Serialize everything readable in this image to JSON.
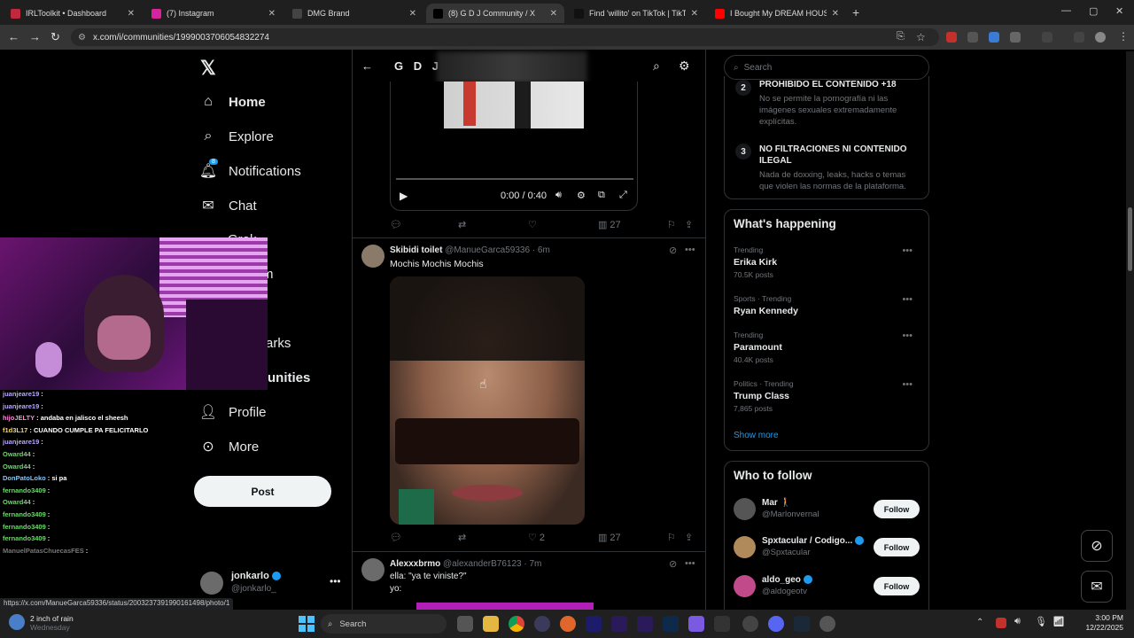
{
  "tabs": [
    {
      "title": "IRLToolkit • Dashboard",
      "favicon_color": "#c0283c",
      "active": false
    },
    {
      "title": "(7) Instagram",
      "favicon_color": "#d6249f",
      "active": false
    },
    {
      "title": "DMG Brand",
      "favicon_color": "#444444",
      "active": false
    },
    {
      "title": "(8) G D J Community / X",
      "favicon_color": "#000000",
      "active": true
    },
    {
      "title": "Find 'willito' on TikTok | TikTok S",
      "favicon_color": "#111111",
      "active": false
    },
    {
      "title": "I Bought My DREAM HOUSE At",
      "favicon_color": "#ff0000",
      "active": false
    }
  ],
  "url": "x.com/i/communities/1999003706054832274",
  "nav": {
    "home": "Home",
    "explore": "Explore",
    "notifications": "Notifications",
    "notif_badge": "8",
    "chat": "Chat",
    "grok": "Grok",
    "communities_partial": "m",
    "bookmarks_partial": "arks",
    "communities2_partial": "unities",
    "profile": "Profile",
    "more": "More",
    "post": "Post"
  },
  "account": {
    "name": "jonkarlo",
    "handle": "@jonkarlo_"
  },
  "community": {
    "title": "G D J"
  },
  "video": {
    "time": "0:00 / 0:40",
    "views": "27"
  },
  "tweet1": {
    "name": "Skibidi toilet",
    "handle": "@ManueGarca59336",
    "time": "· 6m",
    "text": "Mochis Mochis Mochis",
    "likes": "2",
    "views": "27"
  },
  "tweet2": {
    "name": "Alexxxbrmo",
    "handle": "@alexanderB76123",
    "time": "· 7m",
    "line1": "ella: \"ya te viniste?\"",
    "line2": "yo:"
  },
  "search": {
    "placeholder": "Search"
  },
  "rules": [
    {
      "num": "2",
      "title": "PROHIBIDO EL CONTENIDO +18",
      "desc": "No se permite la pornografía ni las imágenes sexuales extremadamente explícitas."
    },
    {
      "num": "3",
      "title": "NO FILTRACIONES NI CONTENIDO ILEGAL",
      "desc": "Nada de doxxing, leaks, hacks o temas que violen las normas de la plataforma."
    }
  ],
  "happening": {
    "title": "What's happening",
    "show_more": "Show more",
    "trends": [
      {
        "meta": "Trending",
        "topic": "Erika Kirk",
        "count": "70.5K posts"
      },
      {
        "meta": "Sports · Trending",
        "topic": "Ryan Kennedy",
        "count": ""
      },
      {
        "meta": "Trending",
        "topic": "Paramount",
        "count": "40.4K posts"
      },
      {
        "meta": "Politics · Trending",
        "topic": "Trump Class",
        "count": "7,865 posts"
      }
    ]
  },
  "who_to_follow": {
    "title": "Who to follow",
    "follow_label": "Follow",
    "people": [
      {
        "name": "Mar 🚶",
        "handle": "@Marlonvernal"
      },
      {
        "name": "Spxtacular / Codigo...",
        "handle": "@Spxtacular"
      },
      {
        "name": "aldo_geo",
        "handle": "@aldogeotv"
      }
    ]
  },
  "chat": [
    {
      "user": "juanjeare19",
      "msg": ":",
      "color": "#b9a6ff"
    },
    {
      "user": "juanjeare19",
      "msg": ":",
      "color": "#b9a6ff"
    },
    {
      "user": "hijoJELTY",
      "msg": ": andaba en jalisco el sheesh",
      "color": "#ff8ad8"
    },
    {
      "user": "f1d3L17",
      "msg": ": CUANDO CUMPLE PA FELICITARLO",
      "color": "#ffd84a"
    },
    {
      "user": "juanjeare19",
      "msg": ":",
      "color": "#b9a6ff"
    },
    {
      "user": "Oward44",
      "msg": ":",
      "color": "#6cd96c"
    },
    {
      "user": "Oward44",
      "msg": ":",
      "color": "#6cd96c"
    },
    {
      "user": "DonPatoLoko",
      "msg": ": si pa",
      "color": "#7fc7ff"
    },
    {
      "user": "fernando3409",
      "msg": ":",
      "color": "#6cd96c"
    },
    {
      "user": "Oward44",
      "msg": ":",
      "color": "#6cd96c"
    },
    {
      "user": "fernando3409",
      "msg": ":",
      "color": "#6cd96c"
    },
    {
      "user": "fernando3409",
      "msg": ":",
      "color": "#6cd96c"
    },
    {
      "user": "fernando3409",
      "msg": ":",
      "color": "#6cd96c"
    },
    {
      "user": "ManuelPatasChuecasFES",
      "msg": ":",
      "color": "#777777"
    }
  ],
  "status_url": "https://x.com/ManueGarca59336/status/2003237391990161498/photo/1",
  "weather": {
    "line1": "2 inch of rain",
    "line2": "Wednesday"
  },
  "taskbar": {
    "search": "Search",
    "time": "3:00 PM",
    "date": "12/22/2025"
  }
}
